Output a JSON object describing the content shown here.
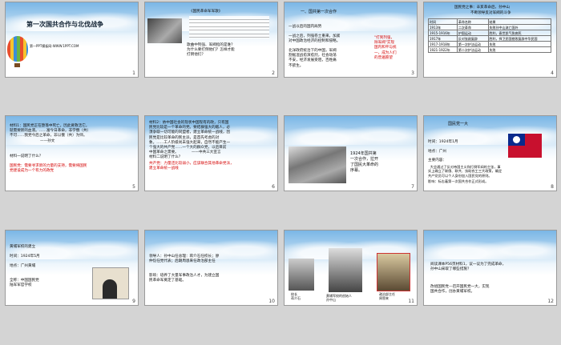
{
  "slides": [
    {
      "n": "1",
      "title": "第一次国共合作与北伐战争",
      "footer": "第一PPT模板网-WWW.1PPT.COM"
    },
    {
      "n": "2",
      "song": "《国民革命军军歌》",
      "text": "歌曲中列强、军阀指的是谁？\n为什么要打倒他们？怎样才能\n打倒他们？"
    },
    {
      "n": "3",
      "heading": "一、国共第一次合作",
      "l1": "一战以后的国内局势",
      "l2": "一战之后，列强卷土重来，加紧\n对中国政治经济的控制和侵略。",
      "l3": "北洋政府统治下的中国，军阀\n割据混战愈演愈烈，社会动荡\n不安，经济发展受阻，百姓痛\n不欲生。",
      "red": "\"打到列强，\n除军阀\"实现\n国内和平与统\n一，成为人们\n的普遍愿望"
    },
    {
      "n": "4",
      "title1": "国民党之事：辛亥革命后，孙中山",
      "title2": "不断领导反对军阀的斗争",
      "headers": [
        "时间",
        "革命名称",
        "结果"
      ],
      "rows": [
        [
          "1913年",
          "二次革命",
          "失败孙中山流亡国外"
        ],
        [
          "1915-1916年",
          "护国运动",
          "胜利，袁世凯气急病死"
        ],
        [
          "1917年",
          "反对张勋复辟",
          "胜利，捍卫民国挫败复辟中华民国"
        ],
        [
          "1917-1918年",
          "第一次护法运动",
          "失败"
        ],
        [
          "1921-1922年",
          "第二次护法运动",
          "失败"
        ]
      ]
    },
    {
      "n": "5",
      "body": "材料1：国民党正在堕落中死亡，因此要救活它，\n就需要新的血液。……富今日革命，非学俄（共）\n不可……我党今后之革命，非以俄（共）为师。\n                          ——孙文",
      "q": "材料一说明了什么？",
      "red": "国民党：需要寻求新的力量的支持，需要将国民\n党建设成为一个有力的政党"
    },
    {
      "n": "6",
      "body": "材料2：依中国社会的现状中国现有的政，只有国\n民党比较是一个革命的党。要结群强大的敌人，必\n须争取一切可能的同盟者，建立革命统一战线，因\n民党是比较革命的民主派，是首先考虑的对\n象。……工人阶级尚未强大起来，自然不能产生一\n个强大的共产党……一个大的群众党，以后目前\n中国革命之需要。           ——中共三大宣言\n材料二说明了什么？",
      "red": "共产党：力量还比较弱小，应该联合其他革命党派，\n建立革命统一战线"
    },
    {
      "n": "7",
      "text": "1924年国共第\n一次合作，拉开\n了国民大革命的\n序幕。"
    },
    {
      "n": "8",
      "heading": "国民党一大",
      "time": "时间：1924年1月",
      "place": "地点：广州",
      "content": "主要内容：",
      "detail": "  大会通过了反对帝国主义和打倒军阀的主张，事\n实上确立了联俄、联共、扶助农工三大政策，确定\n共产党员可以个人身份加入国民党的原则。",
      "effect": "影响：标志着第一次国共合作正式形成。"
    },
    {
      "n": "9",
      "heading": "黄埔军校的建立",
      "time": "时间：1924年5月",
      "place": "地点：广州黄埔",
      "name": "全称：中国国民党\n陆军军官学校"
    },
    {
      "n": "10",
      "leaders": "领导人：孙中山任总理：蒋介石任校长；廖\n仲恺任党代表；后期周恩来任政治部主任",
      "effect": "影响：培养了大量军事政治人才，为建立国\n民革命军奠定了基础。"
    },
    {
      "n": "11",
      "cap1": "校长\n蒋介石",
      "cap2": "黄埔军校的创始人\n孙中山",
      "cap3": "政治部主任\n周恩来"
    },
    {
      "n": "12",
      "q": "阅读课本P56页材料1，议一议为了完成革命，\n孙中山采取了哪些措施？",
      "a": "改组国民党—召开国民党一大，实现\n国共合作，创办黄埔军校。"
    }
  ]
}
